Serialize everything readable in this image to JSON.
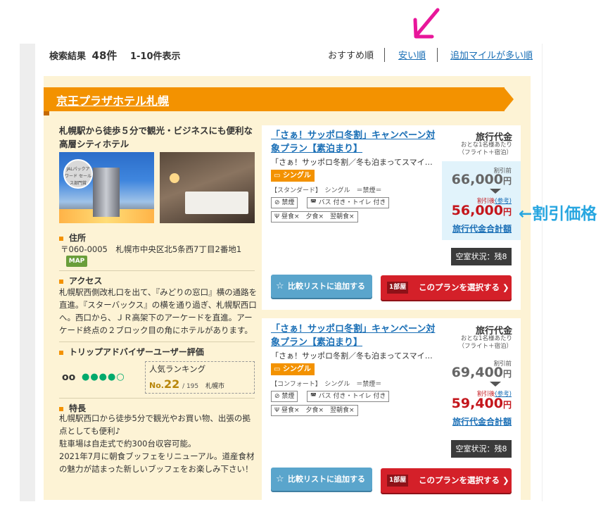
{
  "results": {
    "label": "検索結果",
    "count": "48件",
    "range": "1-10件表示"
  },
  "sort": {
    "recommended": "おすすめ順",
    "cheapest": "安い順",
    "miles": "追加マイルが多い順"
  },
  "colors": {
    "accent_orange": "#f39200",
    "link_blue": "#1a6fb6",
    "price_red": "#c4161c",
    "annotation_blue": "#27a6e0",
    "annotation_pink": "#e8169a"
  },
  "hotel": {
    "name": "京王プラザホテル札幌",
    "tagline": "札幌駅から徒歩５分で観光・ビジネスにも便利な高層シティホテル",
    "photo_badge": "JALパックアワード セールス部門賞",
    "address_title": "住所",
    "address": "〒060-0005　札幌市中央区北5条西7丁目2番地1",
    "map_label": "MAP",
    "access_title": "アクセス",
    "access": "札幌駅西側改札口を出て、『みどりの窓口』横の通路を直進。『スターバックス』の横を通り過ぎ、札幌駅西口へ。西口から、ＪＲ高架下のアーケードを直進。アーケード終点の２ブロック目の角にホテルがあります。",
    "trip_title": "トリップアドバイザーユーザー評価",
    "ta_logo": "oo",
    "rating_bubbles": "●●●●○",
    "rank_label": "人気ランキング",
    "rank_no_prefix": "No.",
    "rank_no": "22",
    "rank_total": "/ 195",
    "rank_city": "札幌市",
    "feature_title": "特長",
    "feature_lines": [
      "札幌駅西口から徒歩5分で観光やお買い物、出張の拠点としても便利♪",
      "駐車場は自走式で約300台収容可能。",
      "2021年7月に朝食ブッフェをリニューアル。道産食材の魅力が詰まった新しいブッフェをお楽しみ下さい！"
    ]
  },
  "plans": [
    {
      "title": "「さぁ！サッポロ冬割」キャンペーン対象プラン【素泊まり】",
      "desc": "「さぁ！サッポロ冬割／冬も泊まってスマイル」",
      "room_tag": "シングル",
      "room_meta": "【スタンダード】　シングル　＝禁煙＝",
      "amenities": [
        "禁煙",
        "バス 付き・トイレ 付き"
      ],
      "meals": "昼食×　夕食×　翌朝食×",
      "price_head": "旅行代金",
      "price_sub1": "おとな1名様あたり",
      "price_sub2": "（フライト＋宿泊）",
      "before_label": "割引前",
      "before_price": "66,000",
      "after_label": "割引後",
      "after_ref": "(参考)",
      "after_price": "56,000",
      "yen": "円",
      "total_link": "旅行代金合計額",
      "vacancy": "空室状況：残8",
      "compare_btn": "比較リストに追加する",
      "rooms_badge": "1部屋",
      "select_btn": "このプランを選択する",
      "chevron": "❯"
    },
    {
      "title": "「さぁ！サッポロ冬割」キャンペーン対象プラン【素泊まり】",
      "desc": "「さぁ！サッポロ冬割／冬も泊まってスマイル」",
      "room_tag": "シングル",
      "room_meta": "【コンフォート】　シングル　＝禁煙＝",
      "amenities": [
        "禁煙",
        "バス 付き・トイレ 付き"
      ],
      "meals": "昼食×　夕食×　翌朝食×",
      "price_head": "旅行代金",
      "price_sub1": "おとな1名様あたり",
      "price_sub2": "（フライト＋宿泊）",
      "before_label": "割引前",
      "before_price": "69,400",
      "after_label": "割引後",
      "after_ref": "(参考)",
      "after_price": "59,400",
      "yen": "円",
      "total_link": "旅行代金合計額",
      "vacancy": "空室状況：残8",
      "compare_btn": "比較リストに追加する",
      "rooms_badge": "1部屋",
      "select_btn": "このプランを選択する",
      "chevron": "❯"
    }
  ],
  "annotation": {
    "discount_label": "←割引価格"
  }
}
